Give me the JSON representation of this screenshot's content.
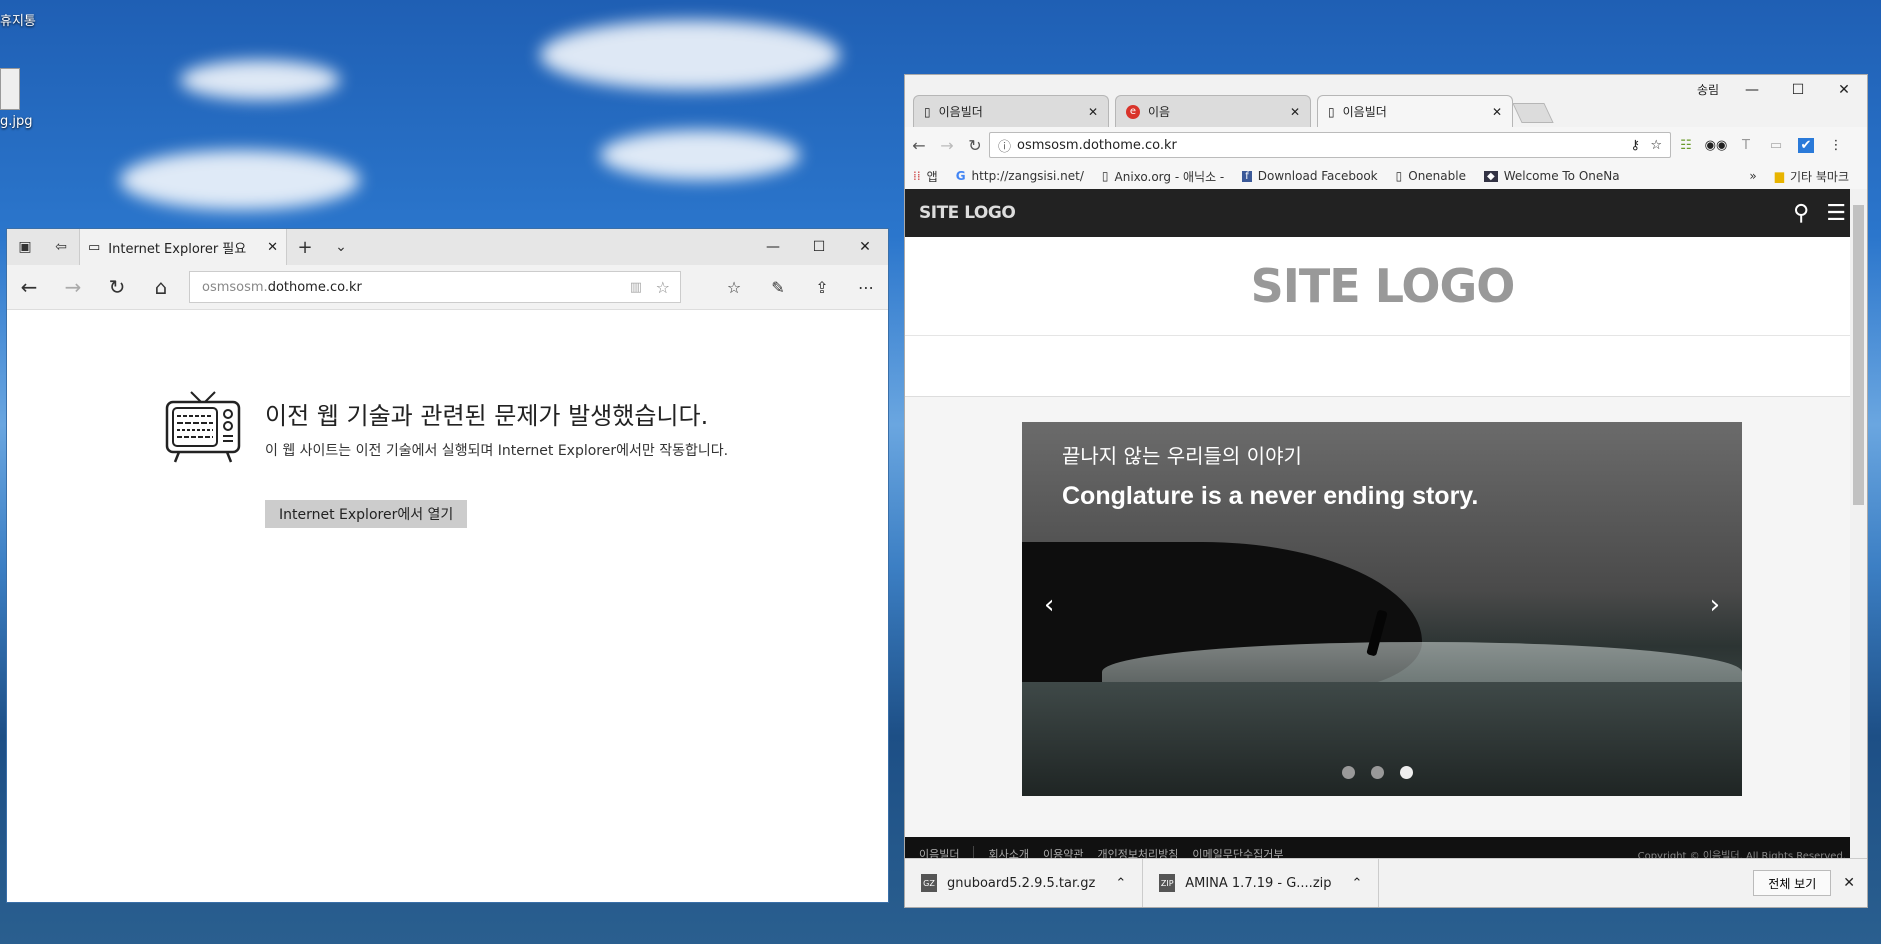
{
  "desktop": {
    "icons": [
      "휴지통",
      "g.jpg"
    ]
  },
  "edge": {
    "tab_title": "Internet Explorer 필요",
    "address_prefix": "osmsosm.",
    "address_host": "dothome.co.kr",
    "message_title": "이전 웹 기술과 관련된 문제가 발생했습니다.",
    "message_body": "이 웹 사이트는 이전 기술에서 실행되며 Internet Explorer에서만 작동합니다.",
    "open_button": "Internet Explorer에서 열기"
  },
  "chrome": {
    "profile_name": "송림",
    "tabs": [
      {
        "label": "이음빌더"
      },
      {
        "label": "이음"
      },
      {
        "label": "이음빌더"
      }
    ],
    "url": "osmsosm.dothome.co.kr",
    "bookmarks": [
      {
        "label": "앱"
      },
      {
        "label": "http://zangsisi.net/"
      },
      {
        "label": "Anixo.org - 애닉소 -"
      },
      {
        "label": "Download Facebook"
      },
      {
        "label": "Onenable"
      },
      {
        "label": "Welcome To OneNa"
      }
    ],
    "other_bookmarks": "기타 북마크",
    "site": {
      "nav_logo": "SITE LOGO",
      "main_logo": "SITE LOGO",
      "slide_kor": "끝나지 않는 우리들의 이야기",
      "slide_eng": "Conglature is a never ending story.",
      "slide_count": 3,
      "active_slide": 3,
      "footer_links": [
        "이음빌더",
        "회사소개",
        "이용약관",
        "개인정보처리방침",
        "이메일무단수집거부"
      ],
      "copyright": "Copyright © 이음빌더. All Rights Reserved."
    },
    "downloads": [
      {
        "name": "gnuboard5.2.9.5.tar.gz",
        "type": "GZ"
      },
      {
        "name": "AMINA 1.7.19 - G....zip",
        "type": "ZIP"
      }
    ],
    "show_all": "전체 보기"
  }
}
